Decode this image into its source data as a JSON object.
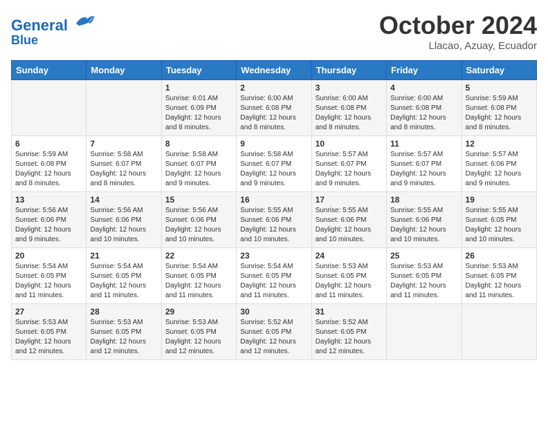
{
  "logo": {
    "line1": "General",
    "line2": "Blue"
  },
  "title": "October 2024",
  "subtitle": "Llacao, Azuay, Ecuador",
  "days_of_week": [
    "Sunday",
    "Monday",
    "Tuesday",
    "Wednesday",
    "Thursday",
    "Friday",
    "Saturday"
  ],
  "weeks": [
    [
      {
        "day": "",
        "sunrise": "",
        "sunset": "",
        "daylight": ""
      },
      {
        "day": "",
        "sunrise": "",
        "sunset": "",
        "daylight": ""
      },
      {
        "day": "1",
        "sunrise": "Sunrise: 6:01 AM",
        "sunset": "Sunset: 6:09 PM",
        "daylight": "Daylight: 12 hours and 8 minutes."
      },
      {
        "day": "2",
        "sunrise": "Sunrise: 6:00 AM",
        "sunset": "Sunset: 6:08 PM",
        "daylight": "Daylight: 12 hours and 8 minutes."
      },
      {
        "day": "3",
        "sunrise": "Sunrise: 6:00 AM",
        "sunset": "Sunset: 6:08 PM",
        "daylight": "Daylight: 12 hours and 8 minutes."
      },
      {
        "day": "4",
        "sunrise": "Sunrise: 6:00 AM",
        "sunset": "Sunset: 6:08 PM",
        "daylight": "Daylight: 12 hours and 8 minutes."
      },
      {
        "day": "5",
        "sunrise": "Sunrise: 5:59 AM",
        "sunset": "Sunset: 6:08 PM",
        "daylight": "Daylight: 12 hours and 8 minutes."
      }
    ],
    [
      {
        "day": "6",
        "sunrise": "Sunrise: 5:59 AM",
        "sunset": "Sunset: 6:08 PM",
        "daylight": "Daylight: 12 hours and 8 minutes."
      },
      {
        "day": "7",
        "sunrise": "Sunrise: 5:58 AM",
        "sunset": "Sunset: 6:07 PM",
        "daylight": "Daylight: 12 hours and 8 minutes."
      },
      {
        "day": "8",
        "sunrise": "Sunrise: 5:58 AM",
        "sunset": "Sunset: 6:07 PM",
        "daylight": "Daylight: 12 hours and 9 minutes."
      },
      {
        "day": "9",
        "sunrise": "Sunrise: 5:58 AM",
        "sunset": "Sunset: 6:07 PM",
        "daylight": "Daylight: 12 hours and 9 minutes."
      },
      {
        "day": "10",
        "sunrise": "Sunrise: 5:57 AM",
        "sunset": "Sunset: 6:07 PM",
        "daylight": "Daylight: 12 hours and 9 minutes."
      },
      {
        "day": "11",
        "sunrise": "Sunrise: 5:57 AM",
        "sunset": "Sunset: 6:07 PM",
        "daylight": "Daylight: 12 hours and 9 minutes."
      },
      {
        "day": "12",
        "sunrise": "Sunrise: 5:57 AM",
        "sunset": "Sunset: 6:06 PM",
        "daylight": "Daylight: 12 hours and 9 minutes."
      }
    ],
    [
      {
        "day": "13",
        "sunrise": "Sunrise: 5:56 AM",
        "sunset": "Sunset: 6:06 PM",
        "daylight": "Daylight: 12 hours and 9 minutes."
      },
      {
        "day": "14",
        "sunrise": "Sunrise: 5:56 AM",
        "sunset": "Sunset: 6:06 PM",
        "daylight": "Daylight: 12 hours and 10 minutes."
      },
      {
        "day": "15",
        "sunrise": "Sunrise: 5:56 AM",
        "sunset": "Sunset: 6:06 PM",
        "daylight": "Daylight: 12 hours and 10 minutes."
      },
      {
        "day": "16",
        "sunrise": "Sunrise: 5:55 AM",
        "sunset": "Sunset: 6:06 PM",
        "daylight": "Daylight: 12 hours and 10 minutes."
      },
      {
        "day": "17",
        "sunrise": "Sunrise: 5:55 AM",
        "sunset": "Sunset: 6:06 PM",
        "daylight": "Daylight: 12 hours and 10 minutes."
      },
      {
        "day": "18",
        "sunrise": "Sunrise: 5:55 AM",
        "sunset": "Sunset: 6:06 PM",
        "daylight": "Daylight: 12 hours and 10 minutes."
      },
      {
        "day": "19",
        "sunrise": "Sunrise: 5:55 AM",
        "sunset": "Sunset: 6:05 PM",
        "daylight": "Daylight: 12 hours and 10 minutes."
      }
    ],
    [
      {
        "day": "20",
        "sunrise": "Sunrise: 5:54 AM",
        "sunset": "Sunset: 6:05 PM",
        "daylight": "Daylight: 12 hours and 11 minutes."
      },
      {
        "day": "21",
        "sunrise": "Sunrise: 5:54 AM",
        "sunset": "Sunset: 6:05 PM",
        "daylight": "Daylight: 12 hours and 11 minutes."
      },
      {
        "day": "22",
        "sunrise": "Sunrise: 5:54 AM",
        "sunset": "Sunset: 6:05 PM",
        "daylight": "Daylight: 12 hours and 11 minutes."
      },
      {
        "day": "23",
        "sunrise": "Sunrise: 5:54 AM",
        "sunset": "Sunset: 6:05 PM",
        "daylight": "Daylight: 12 hours and 11 minutes."
      },
      {
        "day": "24",
        "sunrise": "Sunrise: 5:53 AM",
        "sunset": "Sunset: 6:05 PM",
        "daylight": "Daylight: 12 hours and 11 minutes."
      },
      {
        "day": "25",
        "sunrise": "Sunrise: 5:53 AM",
        "sunset": "Sunset: 6:05 PM",
        "daylight": "Daylight: 12 hours and 11 minutes."
      },
      {
        "day": "26",
        "sunrise": "Sunrise: 5:53 AM",
        "sunset": "Sunset: 6:05 PM",
        "daylight": "Daylight: 12 hours and 11 minutes."
      }
    ],
    [
      {
        "day": "27",
        "sunrise": "Sunrise: 5:53 AM",
        "sunset": "Sunset: 6:05 PM",
        "daylight": "Daylight: 12 hours and 12 minutes."
      },
      {
        "day": "28",
        "sunrise": "Sunrise: 5:53 AM",
        "sunset": "Sunset: 6:05 PM",
        "daylight": "Daylight: 12 hours and 12 minutes."
      },
      {
        "day": "29",
        "sunrise": "Sunrise: 5:53 AM",
        "sunset": "Sunset: 6:05 PM",
        "daylight": "Daylight: 12 hours and 12 minutes."
      },
      {
        "day": "30",
        "sunrise": "Sunrise: 5:52 AM",
        "sunset": "Sunset: 6:05 PM",
        "daylight": "Daylight: 12 hours and 12 minutes."
      },
      {
        "day": "31",
        "sunrise": "Sunrise: 5:52 AM",
        "sunset": "Sunset: 6:05 PM",
        "daylight": "Daylight: 12 hours and 12 minutes."
      },
      {
        "day": "",
        "sunrise": "",
        "sunset": "",
        "daylight": ""
      },
      {
        "day": "",
        "sunrise": "",
        "sunset": "",
        "daylight": ""
      }
    ]
  ]
}
